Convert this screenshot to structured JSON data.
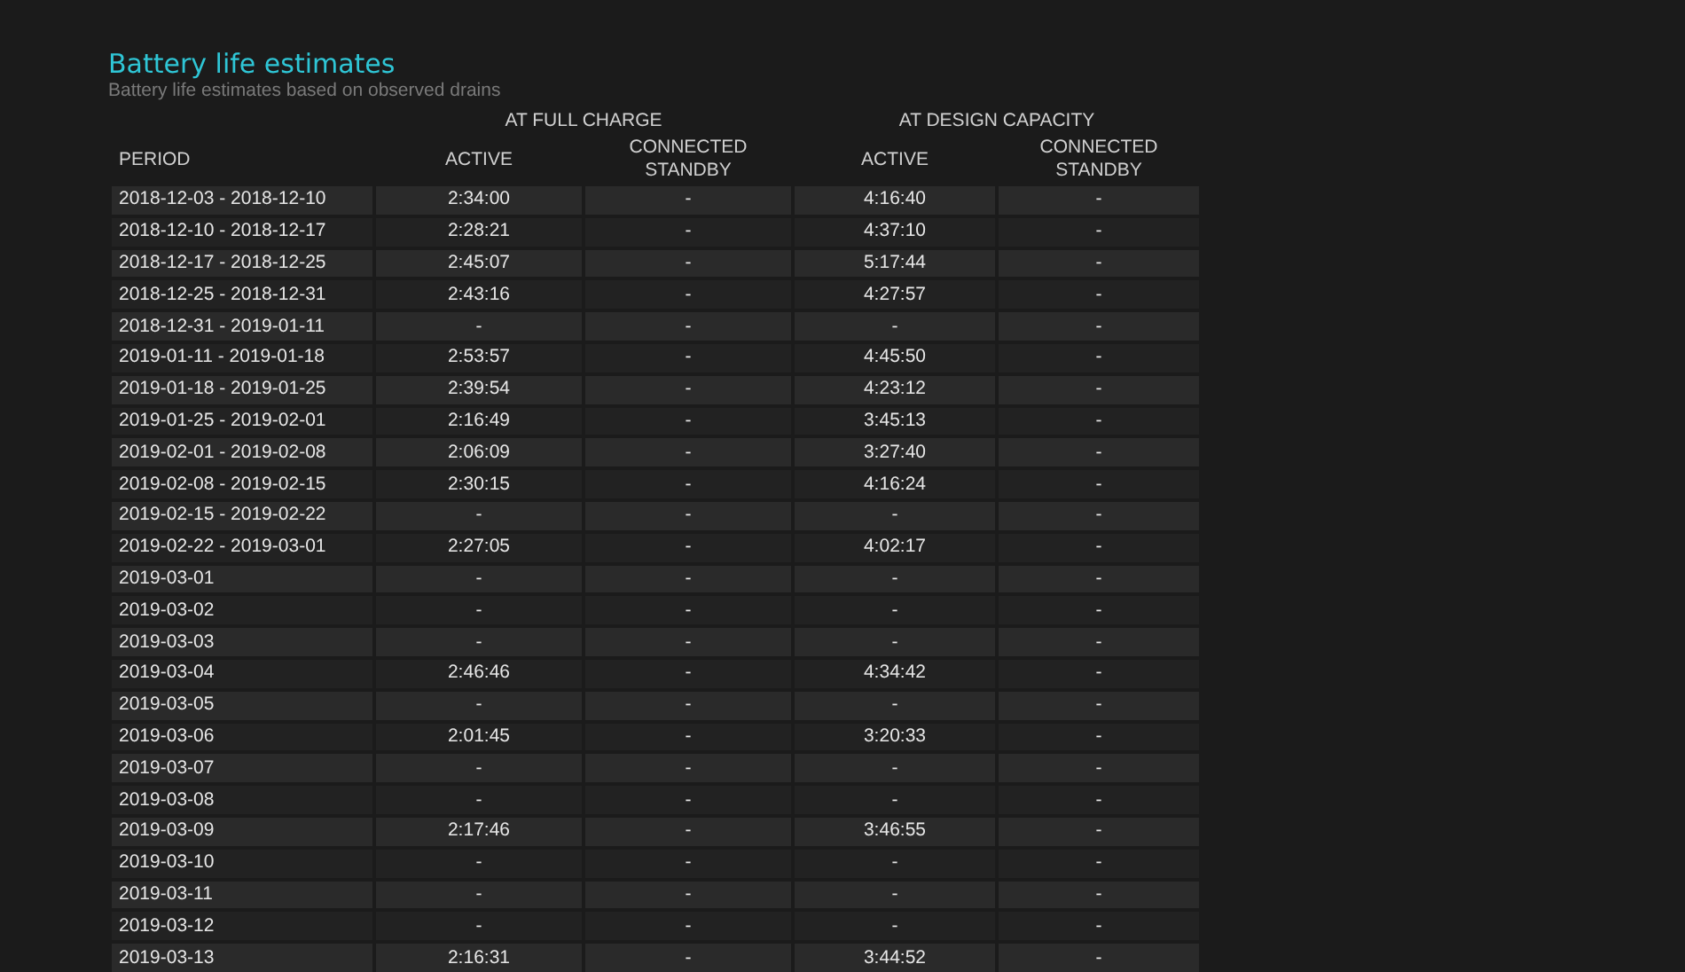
{
  "title": "Battery life estimates",
  "subtitle": "Battery life estimates based on observed drains",
  "table": {
    "groups": [
      "AT FULL CHARGE",
      "AT DESIGN CAPACITY"
    ],
    "columns": [
      "PERIOD",
      "ACTIVE",
      "CONNECTED STANDBY",
      "ACTIVE",
      "CONNECTED STANDBY"
    ],
    "rows": [
      [
        "2018-12-03 - 2018-12-10",
        "2:34:00",
        "-",
        "4:16:40",
        "-"
      ],
      [
        "2018-12-10 - 2018-12-17",
        "2:28:21",
        "-",
        "4:37:10",
        "-"
      ],
      [
        "2018-12-17 - 2018-12-25",
        "2:45:07",
        "-",
        "5:17:44",
        "-"
      ],
      [
        "2018-12-25 - 2018-12-31",
        "2:43:16",
        "-",
        "4:27:57",
        "-"
      ],
      [
        "2018-12-31 - 2019-01-11",
        "-",
        "-",
        "-",
        "-"
      ],
      [
        "2019-01-11 - 2019-01-18",
        "2:53:57",
        "-",
        "4:45:50",
        "-"
      ],
      [
        "2019-01-18 - 2019-01-25",
        "2:39:54",
        "-",
        "4:23:12",
        "-"
      ],
      [
        "2019-01-25 - 2019-02-01",
        "2:16:49",
        "-",
        "3:45:13",
        "-"
      ],
      [
        "2019-02-01 - 2019-02-08",
        "2:06:09",
        "-",
        "3:27:40",
        "-"
      ],
      [
        "2019-02-08 - 2019-02-15",
        "2:30:15",
        "-",
        "4:16:24",
        "-"
      ],
      [
        "2019-02-15 - 2019-02-22",
        "-",
        "-",
        "-",
        "-"
      ],
      [
        "2019-02-22 - 2019-03-01",
        "2:27:05",
        "-",
        "4:02:17",
        "-"
      ],
      [
        "2019-03-01",
        "-",
        "-",
        "-",
        "-"
      ],
      [
        "2019-03-02",
        "-",
        "-",
        "-",
        "-"
      ],
      [
        "2019-03-03",
        "-",
        "-",
        "-",
        "-"
      ],
      [
        "2019-03-04",
        "2:46:46",
        "-",
        "4:34:42",
        "-"
      ],
      [
        "2019-03-05",
        "-",
        "-",
        "-",
        "-"
      ],
      [
        "2019-03-06",
        "2:01:45",
        "-",
        "3:20:33",
        "-"
      ],
      [
        "2019-03-07",
        "-",
        "-",
        "-",
        "-"
      ],
      [
        "2019-03-08",
        "-",
        "-",
        "-",
        "-"
      ],
      [
        "2019-03-09",
        "2:17:46",
        "-",
        "3:46:55",
        "-"
      ],
      [
        "2019-03-10",
        "-",
        "-",
        "-",
        "-"
      ],
      [
        "2019-03-11",
        "-",
        "-",
        "-",
        "-"
      ],
      [
        "2019-03-12",
        "-",
        "-",
        "-",
        "-"
      ],
      [
        "2019-03-13",
        "2:16:31",
        "-",
        "3:44:52",
        "-"
      ]
    ]
  }
}
